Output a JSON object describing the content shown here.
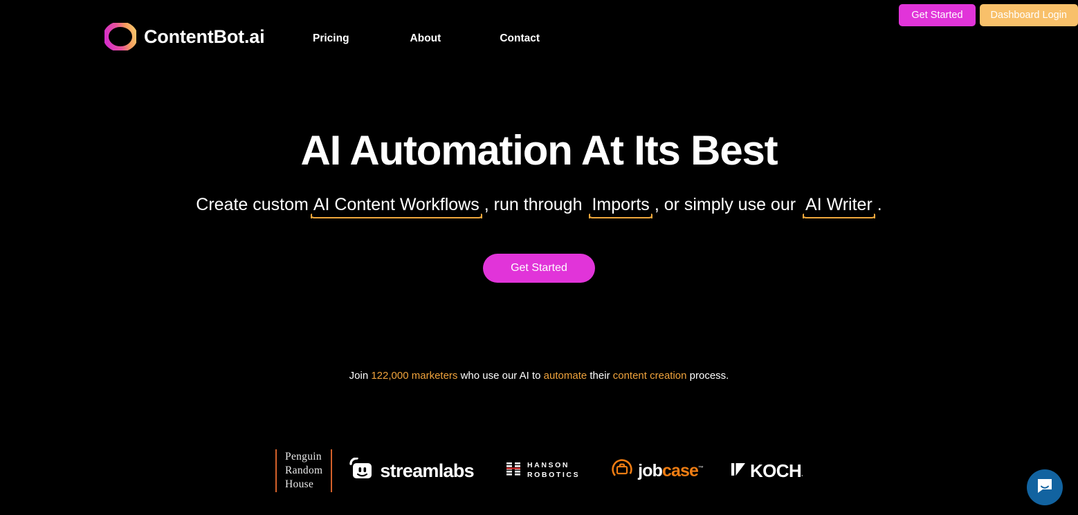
{
  "brand": {
    "name": "ContentBot.ai",
    "logo_icon": "gradient-ring-icon",
    "gradient_start": "#e134d9",
    "gradient_end": "#f8c06a"
  },
  "header": {
    "nav": [
      {
        "label": "Pricing"
      },
      {
        "label": "About"
      },
      {
        "label": "Contact"
      }
    ],
    "actions": {
      "get_started": "Get Started",
      "dashboard_login": "Dashboard Login",
      "get_started_color": "#e134d9",
      "dashboard_login_color": "#f8c06a"
    }
  },
  "hero": {
    "title": "AI Automation At Its Best",
    "subtitle": {
      "part1": "Create custom",
      "link1": "AI Content Workflows",
      "part2": ", run through",
      "link2": "Imports",
      "part3": ", or simply use our",
      "link3": "AI Writer",
      "part4": ".",
      "underline_color": "#f0a83c"
    },
    "cta": "Get Started",
    "cta_color": "#e134d9"
  },
  "social_proof": {
    "p1": "Join ",
    "h1": "122,000 marketers",
    "p2": " who use our AI to ",
    "h2": "automate",
    "p3": " their ",
    "h3": "content creation",
    "p4": " process.",
    "highlight_color": "#f0a33c"
  },
  "logos": {
    "penguin": {
      "line1": "Penguin",
      "line2": "Random",
      "line3": "House",
      "accent": "#d4612a"
    },
    "streamlabs": {
      "label": "streamlabs"
    },
    "hanson": {
      "line1": "HANSON",
      "line2": "ROBOTICS",
      "accent": "#cc2222"
    },
    "jobcase": {
      "part1": "job",
      "part2": "case",
      "tm": "™",
      "accent": "#f07d13"
    },
    "koch": {
      "label": "KOCH",
      "tm": "⸳"
    }
  },
  "chat": {
    "icon": "chat-bubble-icon",
    "color": "#1263a0"
  }
}
